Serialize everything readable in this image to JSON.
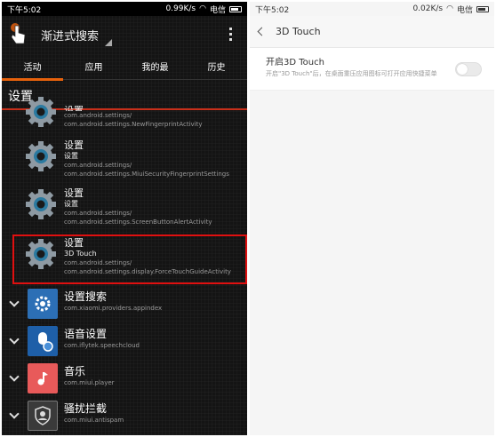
{
  "left": {
    "status": {
      "time": "下午5:02",
      "speed": "0.99K/s",
      "carrier": "电信"
    },
    "app_title": "渐进式搜索",
    "tabs": [
      "活动",
      "应用",
      "我的最",
      "历史"
    ],
    "section_title": "设置",
    "activities": [
      {
        "title": "设置",
        "subtitle": "",
        "package": "com.android.settings/",
        "activity": "com.android.settings.NewFingerprintActivity"
      },
      {
        "title": "设置",
        "subtitle": "设置",
        "package": "com.android.settings/",
        "activity": "com.android.settings.MiuiSecurityFingerprintSettings"
      },
      {
        "title": "设置",
        "subtitle": "设置",
        "package": "com.android.settings/",
        "activity": "com.android.settings.ScreenButtonAlertActivity"
      },
      {
        "title": "设置",
        "subtitle": "3D Touch",
        "package": "com.android.settings/",
        "activity": "com.android.settings.display.ForceTouchGuideActivity"
      }
    ],
    "apps": [
      {
        "title": "设置搜索",
        "package": "com.xiaomi.providers.appindex",
        "icon": "gear-icon",
        "color": "#2c6fb5"
      },
      {
        "title": "语音设置",
        "package": "com.iflytek.speechcloud",
        "icon": "voice-icon",
        "color": "#1e5fa8"
      },
      {
        "title": "音乐",
        "package": "com.miui.player",
        "icon": "music-icon",
        "color": "#e85a5a"
      },
      {
        "title": "骚扰拦截",
        "package": "com.miui.antispam",
        "icon": "shield-icon",
        "color": "#3a3a3a"
      }
    ],
    "accent": "#e8620c",
    "highlight_color": "#e01010"
  },
  "right": {
    "status": {
      "time": "下午5:02",
      "speed": "0.02K/s",
      "carrier": "电信"
    },
    "title": "3D Touch",
    "setting_title": "开启3D Touch",
    "setting_desc": "开启\"3D Touch\"后，在桌面重压应用图标可打开应用快捷菜单",
    "toggle_on": false
  }
}
